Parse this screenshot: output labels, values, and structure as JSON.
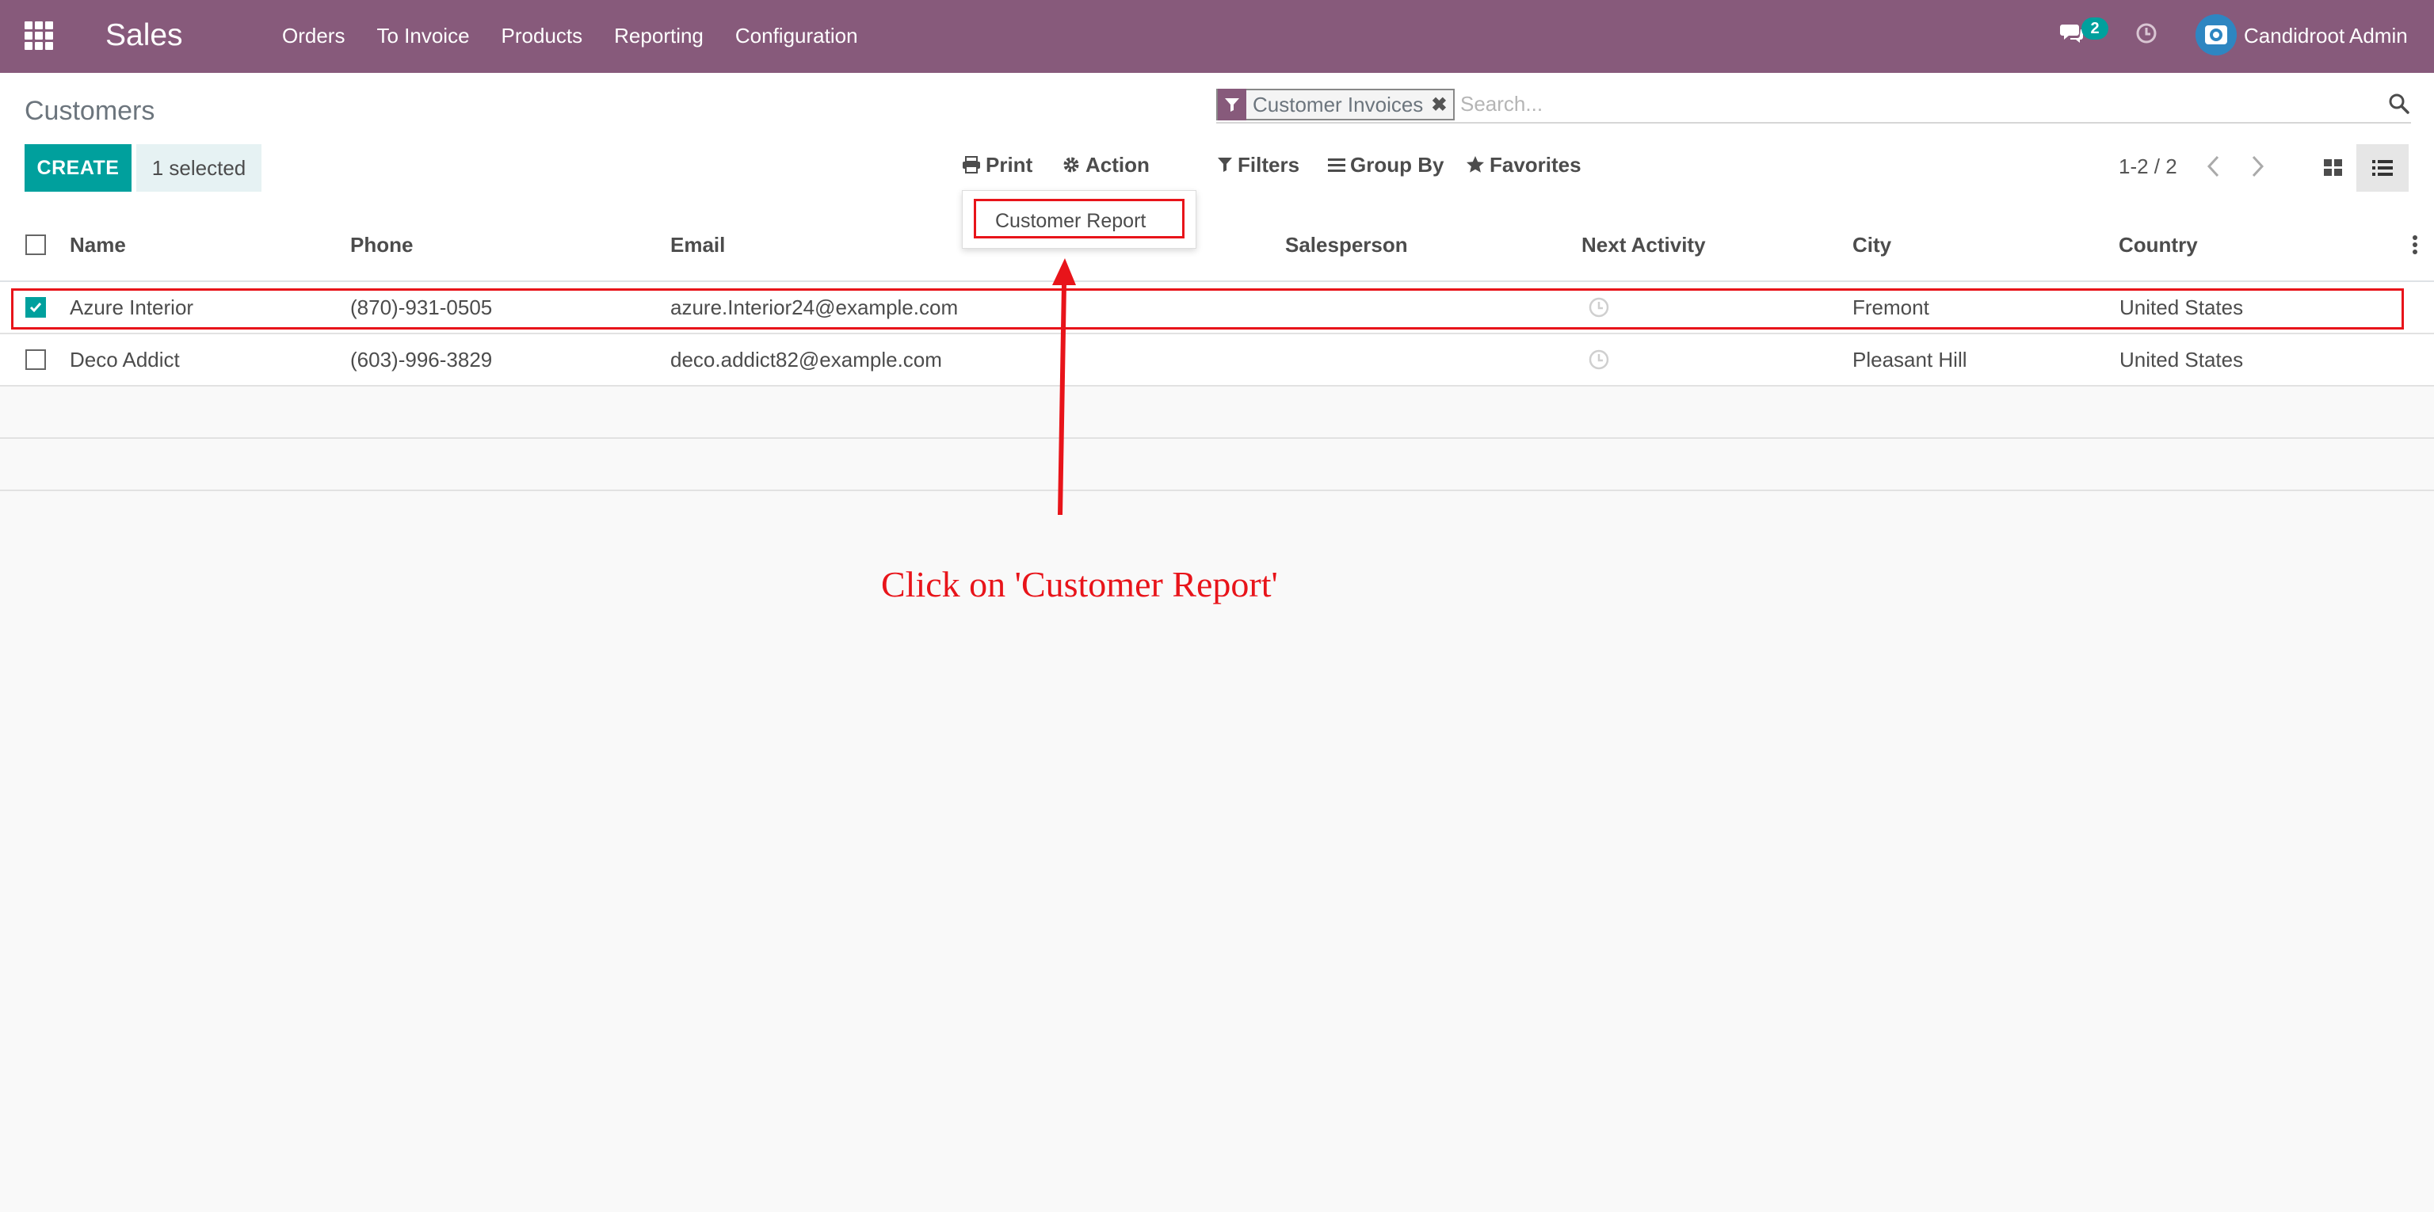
{
  "navbar": {
    "brand": "Sales",
    "menu": [
      "Orders",
      "To Invoice",
      "Products",
      "Reporting",
      "Configuration"
    ],
    "messages_count": "2",
    "user_name": "Candidroot Admin",
    "background": "#875a7b"
  },
  "control_panel": {
    "breadcrumb": "Customers",
    "search": {
      "facet_label": "Customer Invoices",
      "placeholder": "Search..."
    },
    "create_label": "CREATE",
    "selected_label": "1 selected",
    "print_label": "Print",
    "action_label": "Action",
    "filters_label": "Filters",
    "group_by_label": "Group By",
    "favorites_label": "Favorites",
    "pager": "1-2 / 2"
  },
  "action_menu": {
    "items": [
      "Customer Report"
    ]
  },
  "table": {
    "columns": [
      "Name",
      "Phone",
      "Email",
      "Salesperson",
      "Next Activity",
      "City",
      "Country"
    ],
    "rows": [
      {
        "selected": true,
        "name": "Azure Interior",
        "phone": "(870)-931-0505",
        "email": "azure.Interior24@example.com",
        "salesperson": "",
        "city": "Fremont",
        "country": "United States"
      },
      {
        "selected": false,
        "name": "Deco Addict",
        "phone": "(603)-996-3829",
        "email": "deco.addict82@example.com",
        "salesperson": "",
        "city": "Pleasant Hill",
        "country": "United States"
      }
    ]
  },
  "annotation": {
    "instruction": "Click on 'Customer Report'",
    "color": "#e8141a"
  },
  "colors": {
    "primary": "#875a7b",
    "accent": "#00a09d"
  }
}
